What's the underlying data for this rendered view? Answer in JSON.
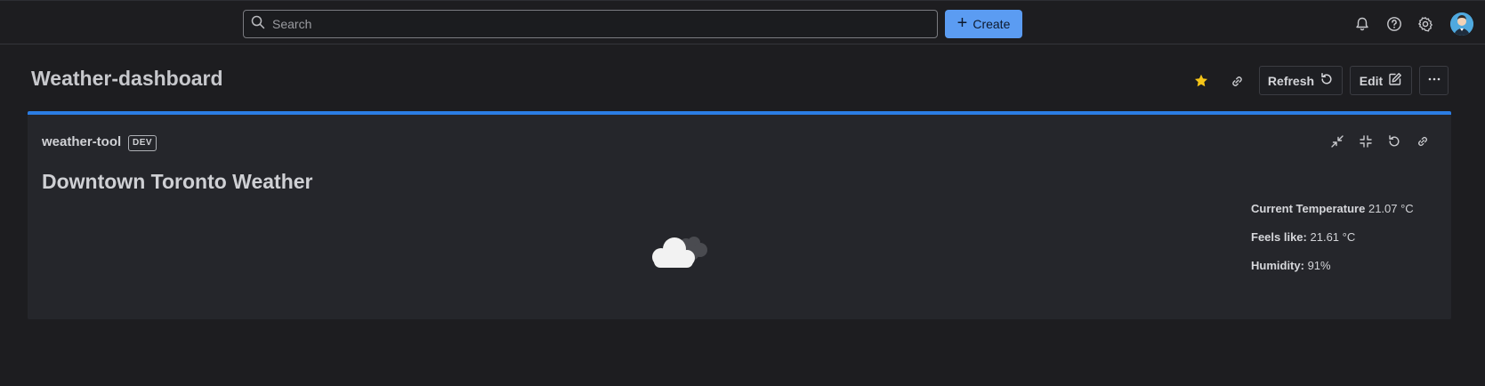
{
  "topbar": {
    "search_placeholder": "Search",
    "create_label": "Create",
    "icons": [
      "bell-icon",
      "help-icon",
      "gear-icon",
      "avatar"
    ]
  },
  "header": {
    "title": "Weather-dashboard",
    "refresh_label": "Refresh",
    "edit_label": "Edit"
  },
  "panel": {
    "name": "weather-tool",
    "badge": "DEV",
    "weather_title": "Downtown Toronto Weather",
    "condition_icon": "cloud-icon",
    "stats": [
      {
        "label": "Current Temperature",
        "value": "21.07 °C"
      },
      {
        "label": "Feels like:",
        "value": "21.61 °C"
      },
      {
        "label": "Humidity:",
        "value": "91%"
      }
    ]
  },
  "colors": {
    "background": "#1d1d20",
    "panel": "#25262b",
    "accent": "#2b7de4",
    "create_button": "#5b9cf2",
    "star": "#f5c518"
  }
}
